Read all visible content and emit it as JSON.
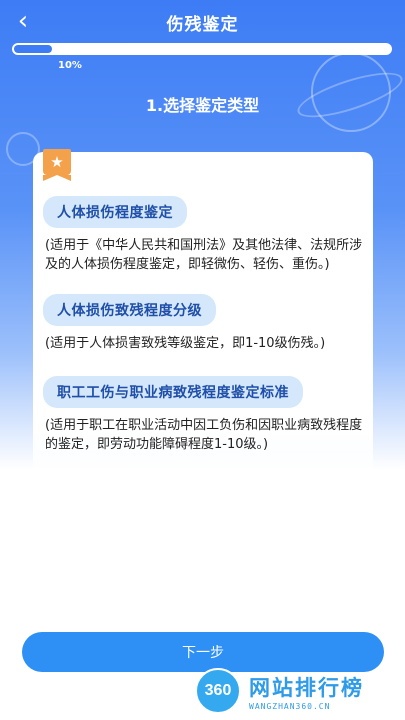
{
  "header": {
    "title": "伤残鉴定",
    "back_icon": "chevron-left-icon"
  },
  "progress": {
    "value": 0.1,
    "label": "10%"
  },
  "step": {
    "title": "1.选择鉴定类型"
  },
  "card": {
    "badge_icon": "star-icon",
    "options": [
      {
        "label": "人体损伤程度鉴定",
        "description": "(适用于《中华人民共和国刑法》及其他法律、法规所涉及的人体损伤程度鉴定，即轻微伤、轻伤、重伤。)"
      },
      {
        "label": "人体损伤致残程度分级",
        "description": "(适用于人体损害致残等级鉴定，即1-10级伤残。)"
      },
      {
        "label": "职工工伤与职业病致残程度鉴定标准",
        "description": "(适用于职工在职业活动中因工负伤和因职业病致残程度的鉴定，即劳动功能障碍程度1-10级。)"
      }
    ]
  },
  "footer": {
    "next_label": "下一步"
  },
  "watermark": {
    "logo": "360",
    "text": "网站排行榜",
    "url": "WANGZHAN360.CN"
  },
  "colors": {
    "primary": "#3d7cf5",
    "button": "#2e8ff5",
    "pill_bg": "#d5e8fb",
    "pill_text": "#1f4fa8",
    "badge": "#f3a24b"
  }
}
